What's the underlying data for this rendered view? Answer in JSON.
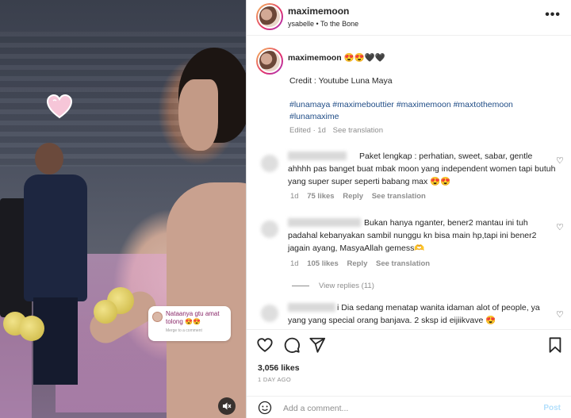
{
  "media": {
    "sticker_question": "Nataanya gtu amat tolong 😍😍",
    "sticker_sub": "Merge to a comment"
  },
  "header": {
    "username": "maximemoon",
    "sub_user": "ysabelle",
    "sub_separator": "•",
    "sub_track": "To the Bone",
    "more": "•••"
  },
  "caption": {
    "username": "maximemoon",
    "emoji": "😍😍🖤🖤",
    "credit": "Credit : Youtube Luna Maya",
    "hashtags": "#lunamaya #maximebouttier #maximemoon #maxtothemoon #lunamaxime",
    "edited": "Edited",
    "age": "1d",
    "see_translation": "See translation"
  },
  "comments": [
    {
      "text": "Paket lengkap : perhatian, sweet, sabar, gentle ahhhh pas banget buat mbak moon yang independent women tapi butuh yang super super seperti babang max 😍😍",
      "age": "1d",
      "likes": "75 likes",
      "reply": "Reply",
      "see_translation": "See translation"
    },
    {
      "text": "Bukan hanya nganter, bener2 mantau ini tuh padahal kebanyakan sambil nunggu kn bisa main hp,tapi ini bener2 jagain ayang, MasyaAllah gemess🫶",
      "age": "1d",
      "likes": "105 likes",
      "reply": "Reply",
      "see_translation": "See translation"
    },
    {
      "text": "i Dia sedang menatap wanita idaman alot of people, ya yang yang special orang banjava.  2 sksp id eijiikvave 😍"
    }
  ],
  "view_replies": "View replies (11)",
  "likes_count": "3,056 likes",
  "post_date": "1 DAY AGO",
  "add_comment_placeholder": "Add a comment...",
  "post_label": "Post",
  "colors": {
    "link": "#1f4c86",
    "muted": "#8e8e8e",
    "post_disabled": "#b2dffc"
  }
}
